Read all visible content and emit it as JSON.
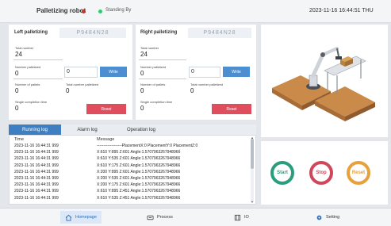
{
  "header": {
    "app_title": "Palletizing robot",
    "status_text": "Standing By",
    "datetime": "2023-11-16 16:44:51",
    "weekday": "THU"
  },
  "left": {
    "title": "Left palletizing",
    "code": "P9484N28",
    "total_number_label": "Total number",
    "total_number": "24",
    "number_palletized_label": "Number palletized",
    "number_palletized": "0",
    "input_value": "0",
    "write_label": "Write",
    "number_of_pallets_label": "Number of pallets",
    "number_of_pallets": "0",
    "total_palletized_label": "Total number palletized",
    "total_palletized": "0",
    "single_time_label": "Single completion time",
    "single_time": "0",
    "reset_label": "Reset"
  },
  "right": {
    "title": "Right palletizing",
    "code": "P9484N28",
    "total_number_label": "Total number",
    "total_number": "24",
    "number_palletized_label": "Number palletized",
    "number_palletized": "0",
    "input_value": "0",
    "write_label": "Write",
    "number_of_pallets_label": "Number of pallets",
    "number_of_pallets": "0",
    "total_palletized_label": "Total number palletized",
    "total_palletized": "0",
    "single_time_label": "Single completion time",
    "single_time": "0",
    "reset_label": "Reset"
  },
  "log": {
    "tabs": [
      "Running log",
      "Alarm log",
      "Operation log"
    ],
    "active_tab": 0,
    "columns": [
      "Time",
      "Message"
    ],
    "rows": [
      [
        "2023-11-16 16:44:31 999",
        "-------------------PlacementX:0 PlacementY:0 PlacementZ:0"
      ],
      [
        "2023-11-16 16:44:31 999",
        "X:610 Y:895 Z:601 Angle:1.570796326794896б"
      ],
      [
        "2023-11-16 16:44:31 999",
        "X:610 Y:535 Z:601 Angle:1.5707963267948966"
      ],
      [
        "2023-11-16 16:44:31 999",
        "X:610 Y:175 Z:601 Angle:1.5707963267948966"
      ],
      [
        "2023-11-16 16:44:31 999",
        "X:200 Y:895 Z:601 Angle:1.5707963267948966"
      ],
      [
        "2023-11-16 16:44:31 999",
        "X:200 Y:535 Z:601 Angle:1.5707963267948966"
      ],
      [
        "2023-11-16 16:44:31 999",
        "X:200 Y:175 Z:601 Angle:1.5707963267948966"
      ],
      [
        "2023-11-16 16:44:31 999",
        "X:610 Y:895 Z:451 Angle:1.5707963267948966"
      ],
      [
        "2023-11-16 16:44:31 999",
        "X:610 Y:535 Z:451 Angle:1.5707963267948966"
      ]
    ]
  },
  "controls": {
    "start_label": "Start",
    "stop_label": "Stop",
    "reset_label": "Reset",
    "start_color": "#2a9d7c",
    "stop_color": "#d0465a",
    "reset_color": "#e8a03a"
  },
  "nav": {
    "items": [
      {
        "label": "Homepage",
        "icon": "home-icon"
      },
      {
        "label": "Process",
        "icon": "process-icon"
      },
      {
        "label": "IO",
        "icon": "io-icon"
      },
      {
        "label": "Setting",
        "icon": "gear-icon"
      }
    ],
    "active": 0
  },
  "colors": {
    "accent": "#3e7fc1",
    "reset_button": "#e04e5e",
    "write_button": "#4c8ecf"
  }
}
